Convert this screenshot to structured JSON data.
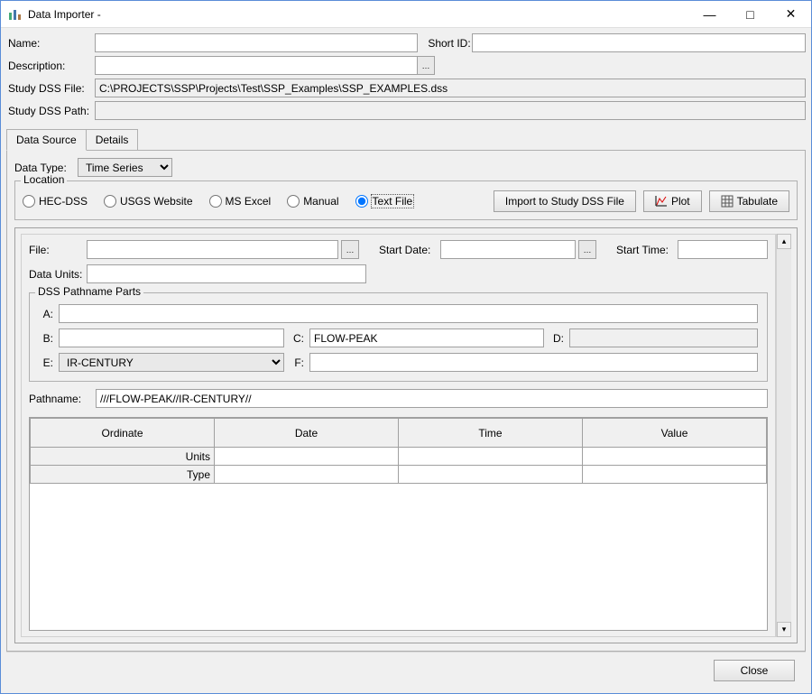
{
  "window": {
    "title": "Data Importer -"
  },
  "header": {
    "name_label": "Name:",
    "name_value": "",
    "shortid_label": "Short ID:",
    "shortid_value": "",
    "desc_label": "Description:",
    "desc_value": "",
    "studydssfile_label": "Study DSS File:",
    "studydssfile_value": "C:\\PROJECTS\\SSP\\Projects\\Test\\SSP_Examples\\SSP_EXAMPLES.dss",
    "studydsspath_label": "Study DSS Path:",
    "studydsspath_value": ""
  },
  "tabs": {
    "source": "Data Source",
    "details": "Details"
  },
  "datatype": {
    "label": "Data Type:",
    "selected": "Time Series"
  },
  "location": {
    "legend": "Location",
    "options": {
      "hecdss": "HEC-DSS",
      "usgs": "USGS Website",
      "msexcel": "MS Excel",
      "manual": "Manual",
      "textfile": "Text File"
    },
    "selected": "textfile"
  },
  "actions": {
    "import": "Import to Study DSS File",
    "plot": "Plot",
    "tabulate": "Tabulate"
  },
  "filerow": {
    "file_label": "File:",
    "file_value": "",
    "startdate_label": "Start Date:",
    "startdate_value": "",
    "starttime_label": "Start Time:",
    "starttime_value": "",
    "dataunits_label": "Data Units:",
    "dataunits_value": ""
  },
  "dssparts": {
    "legend": "DSS Pathname Parts",
    "a_label": "A:",
    "a": "",
    "b_label": "B:",
    "b": "",
    "c_label": "C:",
    "c": "FLOW-PEAK",
    "d_label": "D:",
    "d": "",
    "e_label": "E:",
    "e": "IR-CENTURY",
    "f_label": "F:",
    "f": ""
  },
  "pathname": {
    "label": "Pathname:",
    "value": "///FLOW-PEAK//IR-CENTURY//"
  },
  "table": {
    "headers": [
      "Ordinate",
      "Date",
      "Time",
      "Value"
    ],
    "row_labels": [
      "Units",
      "Type"
    ]
  },
  "footer": {
    "close": "Close"
  }
}
